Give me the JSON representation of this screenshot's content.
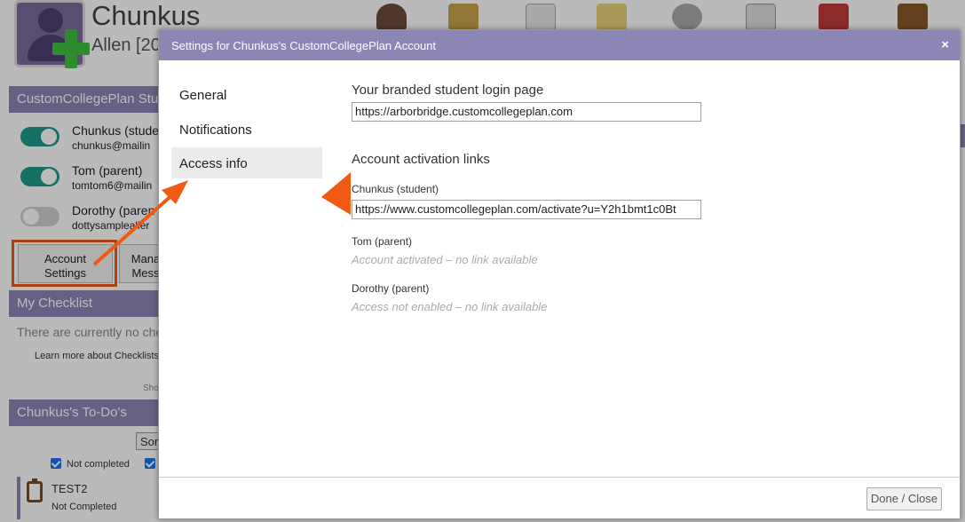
{
  "colors": {
    "header_purple": "#8c86b4",
    "toggle_on": "#1f9a8d",
    "toggle_off": "#d0d0d0",
    "annotation_orange": "#f05a13",
    "checkbox_blue": "#1a73e8"
  },
  "background": {
    "student_name": "Chunkus",
    "student_subtitle": "Allen [20",
    "toolbar_icons": [
      "people-icon",
      "notepad-icon",
      "document-icon",
      "sticky-note-icon",
      "stopwatch-icon",
      "edit-document-icon",
      "calendar-icon",
      "clipboard-icon"
    ],
    "sidebar": {
      "section_title": "CustomCollegePlan Stu",
      "users": [
        {
          "name": "Chunkus (studen",
          "email": "chunkus@mailin",
          "enabled": true
        },
        {
          "name": "Tom (parent)",
          "email": "tomtom6@mailin",
          "enabled": true
        },
        {
          "name": "Dorothy (paren",
          "email": "dottysamplealler",
          "enabled": false
        }
      ],
      "account_settings_label": "Account\nSettings",
      "manage_label": "Mana\nMess",
      "checklist_title": "My Checklist",
      "checklist_empty": "There are currently no che",
      "checklist_learn_more": "Learn more about Checklists",
      "checklist_show": "Sho",
      "todo_title": "Chunkus's To-Do's",
      "todo_sort": "Sor",
      "filter_not_completed": "Not completed",
      "todo_item_title": "TEST2",
      "todo_item_status": "Not Completed"
    }
  },
  "modal": {
    "title": "Settings for Chunkus's CustomCollegePlan Account",
    "close_glyph": "×",
    "nav": [
      {
        "label": "General",
        "active": false
      },
      {
        "label": "Notifications",
        "active": false
      },
      {
        "label": "Access info",
        "active": true
      }
    ],
    "login_page_label": "Your branded student login page",
    "login_page_url": "https://arborbridge.customcollegeplan.com",
    "activation_title": "Account activation links",
    "activation": [
      {
        "label": "Chunkus (student)",
        "link": "https://www.customcollegeplan.com/activate?u=Y2h1bmt1c0Bt",
        "note": ""
      },
      {
        "label": "Tom (parent)",
        "link": "",
        "note": "Account activated – no link available"
      },
      {
        "label": "Dorothy (parent)",
        "link": "",
        "note": "Access not enabled – no link available"
      }
    ],
    "done_label": "Done / Close"
  }
}
